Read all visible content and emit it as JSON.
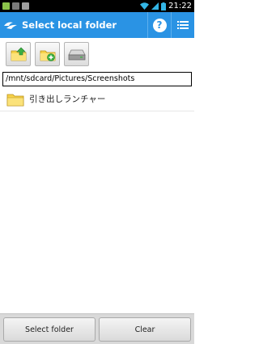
{
  "status_bar": {
    "time": "21:22",
    "icons": [
      "notification-icon",
      "photo-icon",
      "image-icon",
      "wifi-icon",
      "signal-icon",
      "battery-icon"
    ]
  },
  "app_bar": {
    "title": "Select local folder",
    "help_label": "?",
    "accent_color": "#2a93e4"
  },
  "toolbar": {
    "buttons": [
      "parent-folder-icon",
      "new-folder-icon",
      "storage-drive-icon"
    ]
  },
  "path": {
    "current": "/mnt/sdcard/Pictures/Screenshots"
  },
  "file_list": {
    "items": [
      {
        "name": "引き出しランチャー",
        "type": "folder"
      }
    ]
  },
  "bottom_bar": {
    "select_label": "Select folder",
    "clear_label": "Clear"
  }
}
